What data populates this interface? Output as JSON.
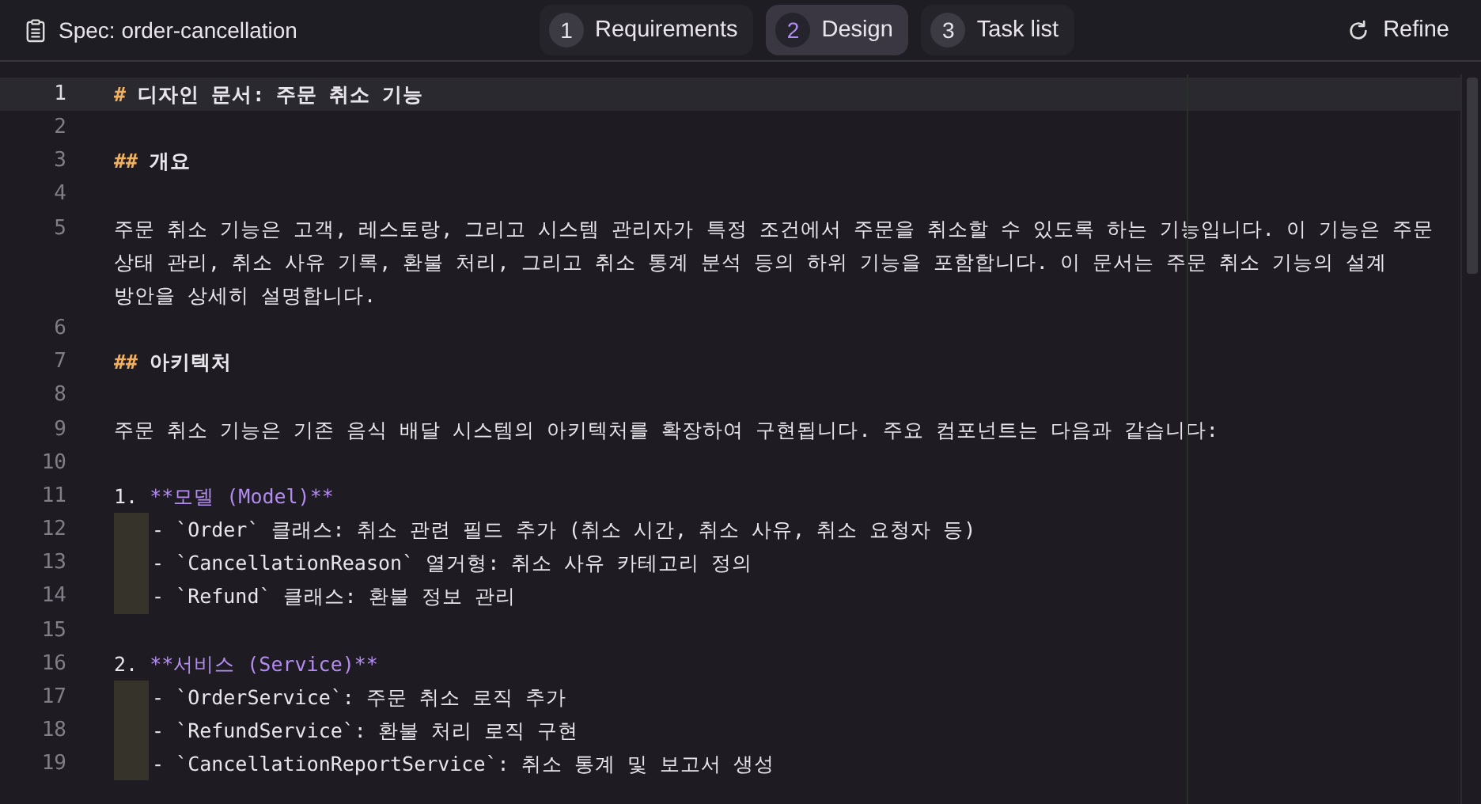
{
  "header": {
    "title": "Spec: order-cancellation",
    "refine": "Refine"
  },
  "tabs": [
    {
      "number": "1",
      "label": "Requirements",
      "selected": false
    },
    {
      "number": "2",
      "label": "Design",
      "selected": true
    },
    {
      "number": "3",
      "label": "Task list",
      "selected": false
    }
  ],
  "editor": {
    "lines": [
      {
        "number": "1",
        "kind": "heading",
        "current": true,
        "marker": "#",
        "text": "디자인 문서: 주문 취소 기능"
      },
      {
        "number": "2",
        "kind": "blank",
        "current": false
      },
      {
        "number": "3",
        "kind": "heading",
        "current": false,
        "marker": "##",
        "text": "개요"
      },
      {
        "number": "4",
        "kind": "blank",
        "current": false
      },
      {
        "number": "5",
        "kind": "text",
        "current": false,
        "text": "주문 취소 기능은 고객, 레스토랑, 그리고 시스템 관리자가 특정 조건에서 주문을 취소할 수 있도록 하는 기능입니다. 이 기능은 주문 상태 관리, 취소 사유 기록, 환불 처리, 그리고 취소 통계 분석 등의 하위 기능을 포함합니다. 이 문서는 주문 취소 기능의 설계 방안을 상세히 설명합니다."
      },
      {
        "number": "6",
        "kind": "blank",
        "current": false
      },
      {
        "number": "7",
        "kind": "heading",
        "current": false,
        "marker": "##",
        "text": "아키텍처"
      },
      {
        "number": "8",
        "kind": "blank",
        "current": false
      },
      {
        "number": "9",
        "kind": "text",
        "current": false,
        "text": "주문 취소 기능은 기존 음식 배달 시스템의 아키텍처를 확장하여 구현됩니다. 주요 컴포넌트는 다음과 같습니다:"
      },
      {
        "number": "10",
        "kind": "blank",
        "current": false
      },
      {
        "number": "11",
        "kind": "list",
        "current": false,
        "marker": "1.",
        "text": "**모델 (Model)**"
      },
      {
        "number": "12",
        "kind": "bullet",
        "current": false,
        "text": "- `Order` 클래스: 취소 관련 필드 추가 (취소 시간, 취소 사유, 취소 요청자 등)"
      },
      {
        "number": "13",
        "kind": "bullet",
        "current": false,
        "text": "- `CancellationReason` 열거형: 취소 사유 카테고리 정의"
      },
      {
        "number": "14",
        "kind": "bullet",
        "current": false,
        "text": "- `Refund` 클래스: 환불 정보 관리"
      },
      {
        "number": "15",
        "kind": "blank",
        "current": false
      },
      {
        "number": "16",
        "kind": "list",
        "current": false,
        "marker": "2.",
        "text": "**서비스 (Service)**"
      },
      {
        "number": "17",
        "kind": "bullet",
        "current": false,
        "text": "- `OrderService`: 주문 취소 로직 추가"
      },
      {
        "number": "18",
        "kind": "bullet",
        "current": false,
        "text": "- `RefundService`: 환불 처리 로직 구현"
      },
      {
        "number": "19",
        "kind": "bullet",
        "current": false,
        "text": "- `CancellationReportService`: 취소 통계 및 보고서 생성"
      }
    ]
  }
}
